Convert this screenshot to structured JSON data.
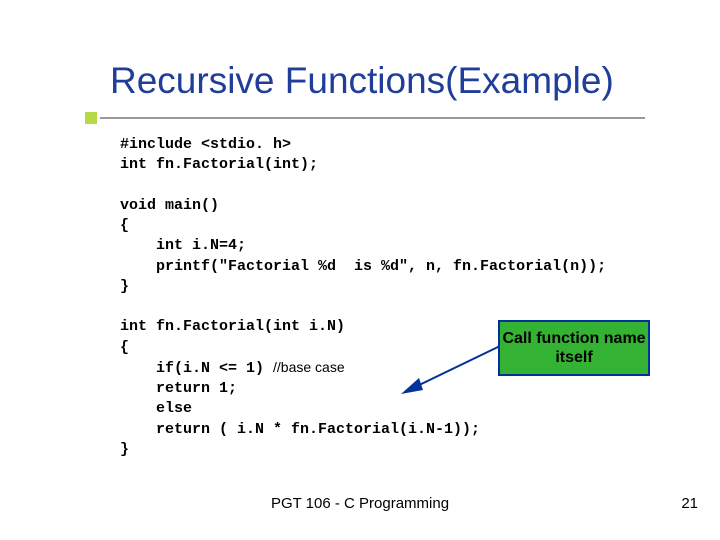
{
  "title": "Recursive Functions(Example)",
  "code": {
    "l1": "#include <stdio. h>",
    "l2": "int fn.Factorial(int);",
    "l3": "",
    "l4": "void main()",
    "l5": "{",
    "l6": "    int i.N=4;",
    "l7": "    printf(\"Factorial %d  is %d\", n, fn.Factorial(n));",
    "l8": "}",
    "l9": "",
    "l10": "int fn.Factorial(int i.N)",
    "l11": "{",
    "l12a": "    if(i.N <= 1) ",
    "l12b": "//base case",
    "l13": "    return 1;",
    "l14": "    else",
    "l15": "    return ( i.N * fn.Factorial(i.N-1));",
    "l16": "}"
  },
  "callout": "Call function name itself",
  "footer": "PGT 106 - C Programming",
  "page": "21"
}
